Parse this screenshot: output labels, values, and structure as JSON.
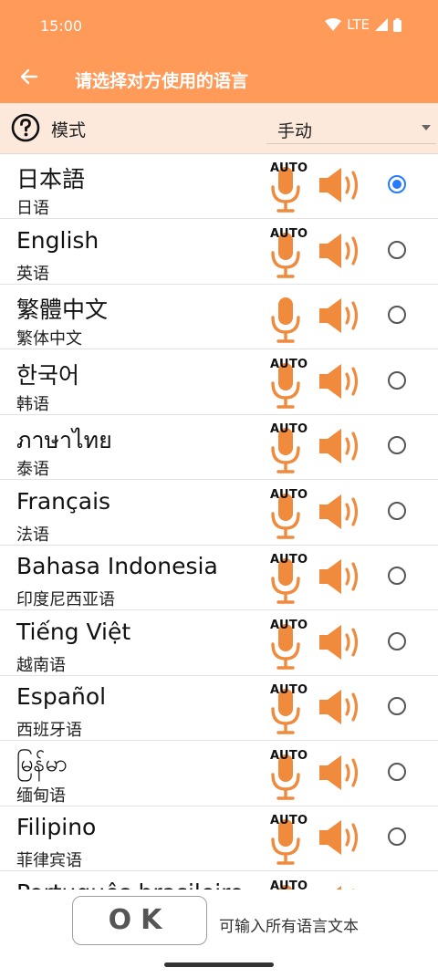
{
  "status": {
    "time": "15:00",
    "network": "LTE"
  },
  "appbar": {
    "title": "请选择对方使用的语言"
  },
  "mode": {
    "label": "模式",
    "value": "手动"
  },
  "languages": [
    {
      "name": "日本語",
      "sub": "日语",
      "auto": "AUTO",
      "selected": true
    },
    {
      "name": "English",
      "sub": "英语",
      "auto": "AUTO",
      "selected": false
    },
    {
      "name": "繁體中文",
      "sub": "繁体中文",
      "auto": "",
      "selected": false
    },
    {
      "name": "한국어",
      "sub": "韩语",
      "auto": "AUTO",
      "selected": false
    },
    {
      "name": "ภาษาไทย",
      "sub": "泰语",
      "auto": "AUTO",
      "selected": false
    },
    {
      "name": "Français",
      "sub": "法语",
      "auto": "AUTO",
      "selected": false
    },
    {
      "name": "Bahasa Indonesia",
      "sub": "印度尼西亚语",
      "auto": "AUTO",
      "selected": false
    },
    {
      "name": "Tiếng Việt",
      "sub": "越南语",
      "auto": "AUTO",
      "selected": false
    },
    {
      "name": "Español",
      "sub": "西班牙语",
      "auto": "AUTO",
      "selected": false
    },
    {
      "name": "မြန်မာ",
      "sub": "缅甸语",
      "auto": "AUTO",
      "selected": false
    },
    {
      "name": "Filipino",
      "sub": "菲律宾语",
      "auto": "AUTO",
      "selected": false
    },
    {
      "name": "Português brasileiro",
      "sub": "",
      "auto": "AUTO",
      "selected": false
    }
  ],
  "footer": {
    "ok_label": "OK",
    "hint": "可输入所有语言文本"
  },
  "colors": {
    "accent": "#ff9a59",
    "icon": "#f08a3c",
    "radio_selected": "#2979ff"
  }
}
